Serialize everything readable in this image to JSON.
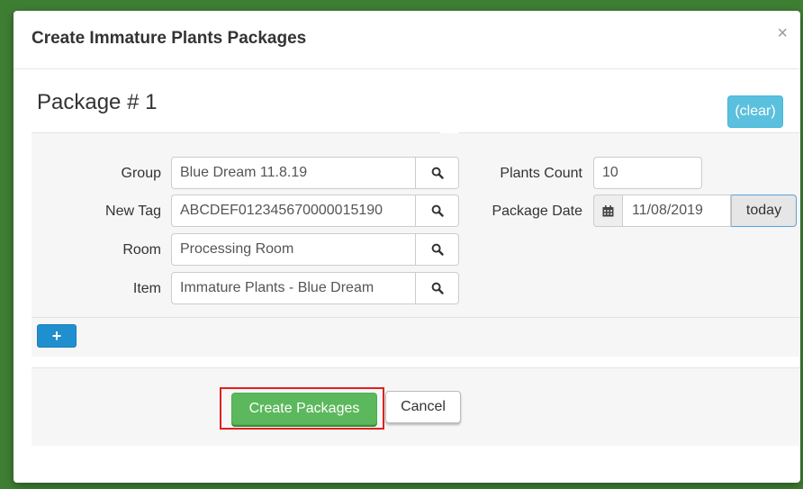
{
  "modal": {
    "title": "Create Immature Plants Packages",
    "close_glyph": "×"
  },
  "package": {
    "title": "Package # 1",
    "clear_label": "(clear)",
    "fields": {
      "group": {
        "label": "Group",
        "value": "Blue Dream 11.8.19"
      },
      "new_tag": {
        "label": "New Tag",
        "value": "ABCDEF012345670000015190"
      },
      "room": {
        "label": "Room",
        "value": "Processing Room"
      },
      "item": {
        "label": "Item",
        "value": "Immature Plants - Blue Dream"
      },
      "plants_count": {
        "label": "Plants Count",
        "value": "10"
      },
      "package_date": {
        "label": "Package Date",
        "value": "11/08/2019",
        "today_label": "today"
      }
    },
    "add_glyph": "+"
  },
  "actions": {
    "create_label": "Create Packages",
    "cancel_label": "Cancel"
  },
  "colors": {
    "backdrop": "#3f7f35",
    "clear_button": "#5bc0de",
    "add_button": "#1f8fcf",
    "create_button": "#5cb85c",
    "highlight": "#e02020"
  },
  "icons": {
    "search": "search-icon",
    "calendar": "calendar-icon",
    "close": "close-icon",
    "plus": "plus-icon"
  }
}
